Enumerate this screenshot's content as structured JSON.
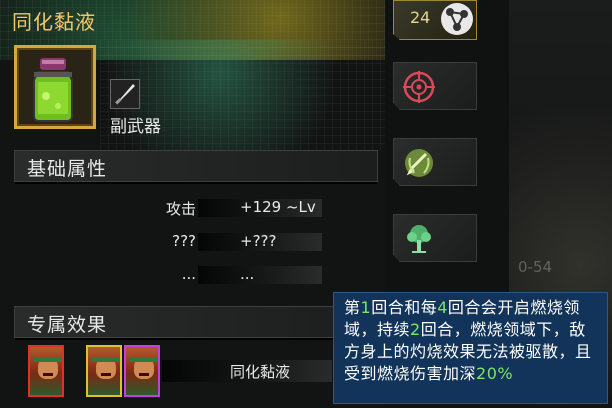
{
  "item": {
    "name": "同化黏液",
    "type_label": "副武器"
  },
  "sections": {
    "base_attributes": "基础属性",
    "exclusive_effect": "专属效果"
  },
  "attributes": [
    {
      "name": "攻击",
      "value": "+129 ~Lv"
    },
    {
      "name": "???",
      "value": "+???"
    },
    {
      "name": "...",
      "value": "..."
    }
  ],
  "exclusive": {
    "effect_name": "同化黏液",
    "heroes": [
      {
        "frame_color": "#e0302a"
      },
      {
        "frame_color": "#e0c030"
      },
      {
        "frame_color": "#c040e0"
      }
    ]
  },
  "tabs": [
    {
      "label": "24",
      "icon": "share-nodes-icon",
      "active": true
    },
    {
      "label": "",
      "icon": "target-icon",
      "active": false
    },
    {
      "label": "",
      "icon": "sword-wreath-icon",
      "active": false
    },
    {
      "label": "",
      "icon": "tree-icon",
      "active": false
    }
  ],
  "background_text": "0-54",
  "tooltip": {
    "segments": [
      {
        "text": "第",
        "hl": false
      },
      {
        "text": "1",
        "hl": true
      },
      {
        "text": "回合和每",
        "hl": false
      },
      {
        "text": "4",
        "hl": true
      },
      {
        "text": "回合会开启燃烧领域，持续",
        "hl": false
      },
      {
        "text": "2",
        "hl": true
      },
      {
        "text": "回合，燃烧领域下，敌方身上的灼烧效果无法被驱散，且受到燃烧伤害加深",
        "hl": false
      },
      {
        "text": "20%",
        "hl": true
      }
    ]
  },
  "colors": {
    "title": "#f4c86a",
    "highlight": "#7ee56a",
    "tooltip_bg": "#12345a",
    "item_frame": "#d6a640"
  }
}
